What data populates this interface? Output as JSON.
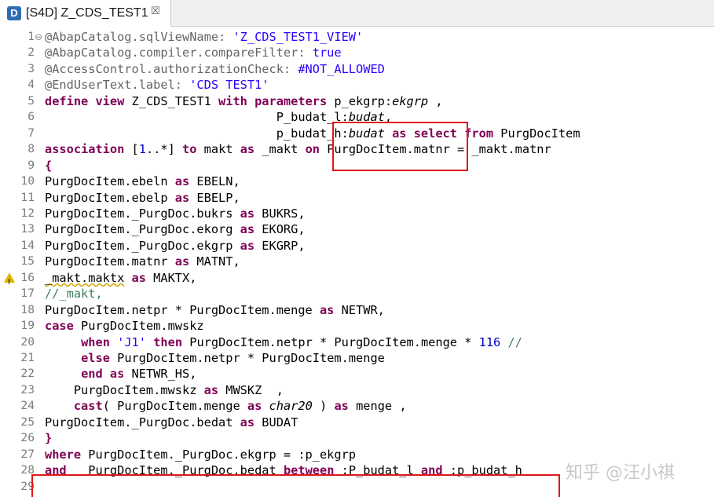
{
  "tab": {
    "icon_letter": "D",
    "title": "[S4D] Z_CDS_TEST1",
    "close": "☒"
  },
  "editor": {
    "lines": [
      {
        "n": "1",
        "tokens": [
          {
            "t": "@AbapCatalog.sqlViewName: ",
            "c": "ann"
          },
          {
            "t": "'Z_CDS_TEST1_VIEW'",
            "c": "str"
          }
        ]
      },
      {
        "n": "2",
        "tokens": [
          {
            "t": "@AbapCatalog.compiler.compareFilter: ",
            "c": "ann"
          },
          {
            "t": "true",
            "c": "str"
          }
        ]
      },
      {
        "n": "3",
        "tokens": [
          {
            "t": "@AccessControl.authorizationCheck: ",
            "c": "ann"
          },
          {
            "t": "#NOT_ALLOWED",
            "c": "str"
          }
        ]
      },
      {
        "n": "4",
        "tokens": [
          {
            "t": "@EndUserText.label: ",
            "c": "ann"
          },
          {
            "t": "'CDS TEST1'",
            "c": "str"
          }
        ]
      },
      {
        "n": "5",
        "tokens": [
          {
            "t": "define view",
            "c": "kw"
          },
          {
            "t": " Z_CDS_TEST1 "
          },
          {
            "t": "with parameters",
            "c": "kw"
          },
          {
            "t": " p_ekgrp:"
          },
          {
            "t": "ekgrp",
            "c": "typ"
          },
          {
            "t": " ,"
          }
        ]
      },
      {
        "n": "6",
        "tokens": [
          {
            "t": "                                P_budat_l:"
          },
          {
            "t": "budat",
            "c": "typ"
          },
          {
            "t": ","
          }
        ]
      },
      {
        "n": "7",
        "tokens": [
          {
            "t": "                                p_budat_h:"
          },
          {
            "t": "budat",
            "c": "typ"
          },
          {
            "t": " "
          },
          {
            "t": "as select from",
            "c": "kw"
          },
          {
            "t": " PurgDocItem"
          }
        ]
      },
      {
        "n": "8",
        "tokens": [
          {
            "t": "association",
            "c": "kw"
          },
          {
            "t": " ["
          },
          {
            "t": "1",
            "c": "num"
          },
          {
            "t": "..*] "
          },
          {
            "t": "to",
            "c": "kw"
          },
          {
            "t": " makt "
          },
          {
            "t": "as",
            "c": "kw"
          },
          {
            "t": " _makt "
          },
          {
            "t": "on",
            "c": "kw"
          },
          {
            "t": " PurgDocItem.matnr = _makt.matnr"
          }
        ]
      },
      {
        "n": "9",
        "tokens": [
          {
            "t": "{",
            "c": "kw"
          }
        ]
      },
      {
        "n": "10",
        "tokens": [
          {
            "t": "PurgDocItem.ebeln "
          },
          {
            "t": "as",
            "c": "kw"
          },
          {
            "t": " EBELN,"
          }
        ]
      },
      {
        "n": "11",
        "tokens": [
          {
            "t": "PurgDocItem.ebelp "
          },
          {
            "t": "as",
            "c": "kw"
          },
          {
            "t": " EBELP,"
          }
        ]
      },
      {
        "n": "12",
        "tokens": [
          {
            "t": "PurgDocItem._PurgDoc.bukrs "
          },
          {
            "t": "as",
            "c": "kw"
          },
          {
            "t": " BUKRS,"
          }
        ]
      },
      {
        "n": "13",
        "tokens": [
          {
            "t": "PurgDocItem._PurgDoc.ekorg "
          },
          {
            "t": "as",
            "c": "kw"
          },
          {
            "t": " EKORG,"
          }
        ]
      },
      {
        "n": "14",
        "tokens": [
          {
            "t": "PurgDocItem._PurgDoc.ekgrp "
          },
          {
            "t": "as",
            "c": "kw"
          },
          {
            "t": " EKGRP,"
          }
        ]
      },
      {
        "n": "15",
        "tokens": [
          {
            "t": "PurgDocItem.matnr "
          },
          {
            "t": "as",
            "c": "kw"
          },
          {
            "t": " MATNT,"
          }
        ]
      },
      {
        "n": "16",
        "tokens": [
          {
            "t": "_makt.maktx",
            "c": "squiggle"
          },
          {
            "t": " "
          },
          {
            "t": "as",
            "c": "kw"
          },
          {
            "t": " MAKTX,"
          }
        ]
      },
      {
        "n": "17",
        "tokens": [
          {
            "t": "//_makt,",
            "c": "cmt"
          }
        ]
      },
      {
        "n": "18",
        "tokens": [
          {
            "t": "PurgDocItem.netpr * PurgDocItem.menge "
          },
          {
            "t": "as",
            "c": "kw"
          },
          {
            "t": " NETWR,"
          }
        ]
      },
      {
        "n": "19",
        "tokens": [
          {
            "t": "case",
            "c": "kw"
          },
          {
            "t": " PurgDocItem.mwskz"
          }
        ]
      },
      {
        "n": "20",
        "tokens": [
          {
            "t": "     "
          },
          {
            "t": "when",
            "c": "kw"
          },
          {
            "t": " "
          },
          {
            "t": "'J1'",
            "c": "str"
          },
          {
            "t": " "
          },
          {
            "t": "then",
            "c": "kw"
          },
          {
            "t": " PurgDocItem.netpr * PurgDocItem.menge * "
          },
          {
            "t": "116",
            "c": "num"
          },
          {
            "t": " "
          },
          {
            "t": "//",
            "c": "cmt"
          }
        ]
      },
      {
        "n": "21",
        "tokens": [
          {
            "t": "     "
          },
          {
            "t": "else",
            "c": "kw"
          },
          {
            "t": " PurgDocItem.netpr * PurgDocItem.menge"
          }
        ]
      },
      {
        "n": "22",
        "tokens": [
          {
            "t": "     "
          },
          {
            "t": "end",
            "c": "kw"
          },
          {
            "t": " "
          },
          {
            "t": "as",
            "c": "kw"
          },
          {
            "t": " NETWR_HS,"
          }
        ]
      },
      {
        "n": "23",
        "tokens": [
          {
            "t": "    PurgDocItem.mwskz "
          },
          {
            "t": "as",
            "c": "kw"
          },
          {
            "t": " MWSKZ  ,"
          }
        ]
      },
      {
        "n": "24",
        "tokens": [
          {
            "t": "    "
          },
          {
            "t": "cast",
            "c": "kw"
          },
          {
            "t": "( PurgDocItem.menge "
          },
          {
            "t": "as",
            "c": "kw"
          },
          {
            "t": " "
          },
          {
            "t": "char20",
            "c": "typ"
          },
          {
            "t": " ) "
          },
          {
            "t": "as",
            "c": "kw"
          },
          {
            "t": " menge ,"
          }
        ]
      },
      {
        "n": "25",
        "tokens": [
          {
            "t": "PurgDocItem._PurgDoc.bedat "
          },
          {
            "t": "as",
            "c": "kw"
          },
          {
            "t": " BUDAT"
          }
        ]
      },
      {
        "n": "26",
        "tokens": [
          {
            "t": "}",
            "c": "kw"
          }
        ]
      },
      {
        "n": "27",
        "tokens": [
          {
            "t": "where",
            "c": "kw"
          },
          {
            "t": " PurgDocItem._PurgDoc.ekgrp = :p_ekgrp"
          }
        ]
      },
      {
        "n": "28",
        "tokens": [
          {
            "t": "and",
            "c": "kw"
          },
          {
            "t": "   PurgDocItem._PurgDoc.bedat "
          },
          {
            "t": "between",
            "c": "kw"
          },
          {
            "t": " :P_budat_l "
          },
          {
            "t": "and",
            "c": "kw"
          },
          {
            "t": " :p_budat_h"
          }
        ]
      },
      {
        "n": "29",
        "tokens": []
      }
    ]
  },
  "watermark": "知乎 @汪小祺",
  "colors": {
    "keyword": "#7f0055",
    "string": "#2a00ff",
    "annotation": "#646464",
    "comment": "#3f7f5f",
    "highlight_box": "#e01818"
  }
}
